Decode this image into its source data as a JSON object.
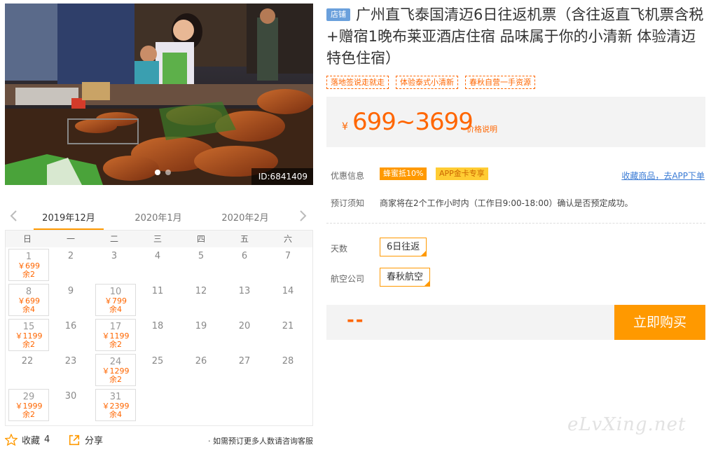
{
  "photo": {
    "id_label": "ID:6841409"
  },
  "months": [
    "2019年12月",
    "2020年1月",
    "2020年2月"
  ],
  "weekdays": [
    "日",
    "一",
    "二",
    "三",
    "四",
    "五",
    "六"
  ],
  "calendar": [
    [
      {
        "d": "1",
        "p": "￥699",
        "r": "余2"
      },
      {
        "d": "2"
      },
      {
        "d": "3"
      },
      {
        "d": "4"
      },
      {
        "d": "5"
      },
      {
        "d": "6"
      },
      {
        "d": "7"
      }
    ],
    [
      {
        "d": "8",
        "p": "￥699",
        "r": "余4"
      },
      {
        "d": "9"
      },
      {
        "d": "10",
        "p": "￥799",
        "r": "余4"
      },
      {
        "d": "11"
      },
      {
        "d": "12"
      },
      {
        "d": "13"
      },
      {
        "d": "14"
      }
    ],
    [
      {
        "d": "15",
        "p": "￥1199",
        "r": "余2"
      },
      {
        "d": "16"
      },
      {
        "d": "17",
        "p": "￥1199",
        "r": "余2"
      },
      {
        "d": "18"
      },
      {
        "d": "19"
      },
      {
        "d": "20"
      },
      {
        "d": "21"
      }
    ],
    [
      {
        "d": "22"
      },
      {
        "d": "23"
      },
      {
        "d": "24",
        "p": "￥1299",
        "r": "余2"
      },
      {
        "d": "25"
      },
      {
        "d": "26"
      },
      {
        "d": "27"
      },
      {
        "d": "28"
      }
    ],
    [
      {
        "d": "29",
        "p": "￥1999",
        "r": "余2"
      },
      {
        "d": "30"
      },
      {
        "d": "31",
        "p": "￥2399",
        "r": "余4"
      }
    ]
  ],
  "bottom": {
    "fav": "收藏",
    "fav_count": "4",
    "share": "分享",
    "note": "· 如需预订更多人数请咨询客服"
  },
  "product": {
    "shop_tag": "店铺",
    "title": "广州直飞泰国清迈6日往返机票（含往返直飞机票含税+赠宿1晚布莱亚酒店住宿 品味属于你的小清新 体验清迈特色住宿）",
    "chips": [
      "落地签说走就走",
      "体验泰式小清新",
      "春秋自营一手资源"
    ],
    "price_yen": "¥",
    "price_range": "699~3699",
    "price_note": "价格说明",
    "promo_label": "优惠信息",
    "promo1": "蜂蜜抵10%",
    "promo2": "APP金卡专享",
    "fav_link": "收藏商品，去APP下单",
    "notice_label": "预订须知",
    "notice": "商家将在2个工作小时内（工作日9:00-18:00）确认是否预定成功。",
    "days_label": "天数",
    "days_value": "6日往返",
    "airline_label": "航空公司",
    "airline_value": "春秋航空",
    "total": "--",
    "buy": "立即购买"
  },
  "watermark": "eLvXing.net",
  "colors": {
    "accent": "#ff9900",
    "price": "#ff6600",
    "link": "#3a7bd5"
  }
}
